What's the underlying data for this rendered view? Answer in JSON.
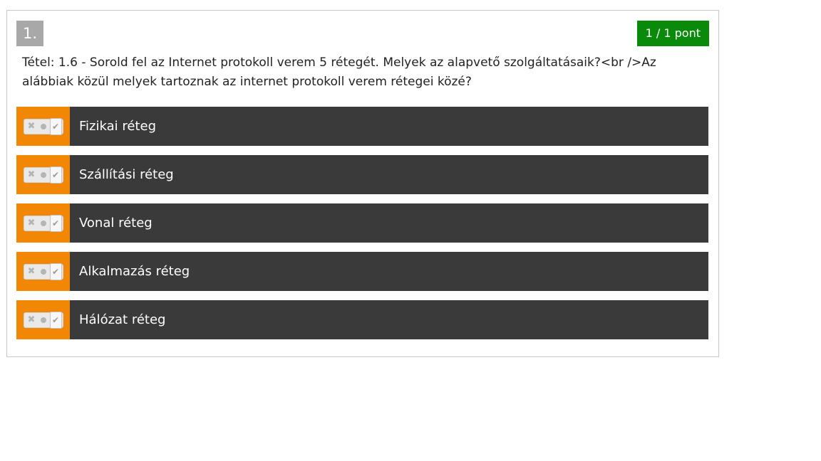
{
  "question": {
    "number": "1.",
    "score": "1 / 1 pont",
    "text": "Tétel: 1.6 - Sorold fel az Internet protokoll verem 5 rétegét. Melyek az alapvető szolgáltatásaik?<br />Az alábbiak közül melyek tartoznak az internet protokoll verem rétegei közé?"
  },
  "options": [
    {
      "label": "Fizikai réteg"
    },
    {
      "label": "Szállítási réteg"
    },
    {
      "label": "Vonal réteg"
    },
    {
      "label": "Alkalmazás réteg"
    },
    {
      "label": "Hálózat réteg"
    }
  ],
  "toggle": {
    "x_glyph": "✖",
    "check_glyph": "✔",
    "icons": [
      "cross-icon",
      "dot-icon",
      "check-icon"
    ]
  },
  "colors": {
    "number_bg": "#a8a8a8",
    "score_bg": "#0a8a0a",
    "toggle_bg": "#f28705",
    "option_bg": "#3a3a3a"
  }
}
